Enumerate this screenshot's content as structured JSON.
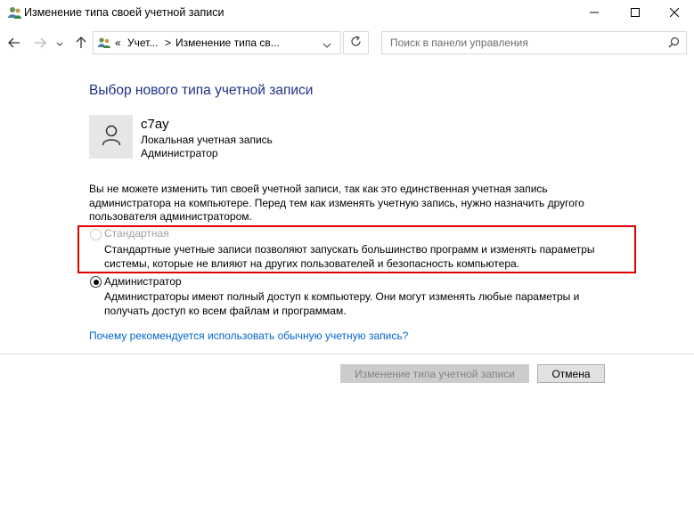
{
  "window": {
    "title": "Изменение типа своей учетной записи"
  },
  "nav": {
    "breadcrumb_overflow": "«",
    "breadcrumb_1": "Учет...",
    "breadcrumb_sep": ">",
    "breadcrumb_2": "Изменение типа св...",
    "search_placeholder": "Поиск в панели управления"
  },
  "main": {
    "heading": "Выбор нового типа учетной записи",
    "user": {
      "name": "c7ay",
      "account_type": "Локальная учетная запись",
      "role": "Администратор"
    },
    "warning": "Вы не можете изменить тип своей учетной записи, так как это единственная учетная запись администратора на компьютере. Перед тем как изменять учетную запись, нужно назначить другого пользователя администратором.",
    "options": [
      {
        "label": "Стандартная",
        "description": "Стандартные учетные записи позволяют запускать большинство программ и изменять параметры системы, которые не влияют на других пользователей и безопасность компьютера.",
        "selected": false,
        "enabled": false
      },
      {
        "label": "Администратор",
        "description": "Администраторы имеют полный доступ к компьютеру. Они могут изменять любые параметры и получать доступ ко всем файлам и программам.",
        "selected": true,
        "enabled": true
      }
    ],
    "help_link": "Почему рекомендуется использовать обычную учетную запись?"
  },
  "buttons": {
    "change_type": "Изменение типа учетной записи",
    "cancel": "Отмена"
  },
  "colors": {
    "heading": "#1e3287",
    "link": "#0066cc",
    "highlight": "#e00000"
  },
  "icons": [
    "users-icon",
    "minimize-icon",
    "maximize-icon",
    "close-icon",
    "back-arrow-icon",
    "forward-arrow-icon",
    "recent-chevron-icon",
    "up-arrow-icon",
    "control-panel-icon",
    "dropdown-chevron-icon",
    "refresh-icon",
    "search-icon",
    "user-icon"
  ]
}
